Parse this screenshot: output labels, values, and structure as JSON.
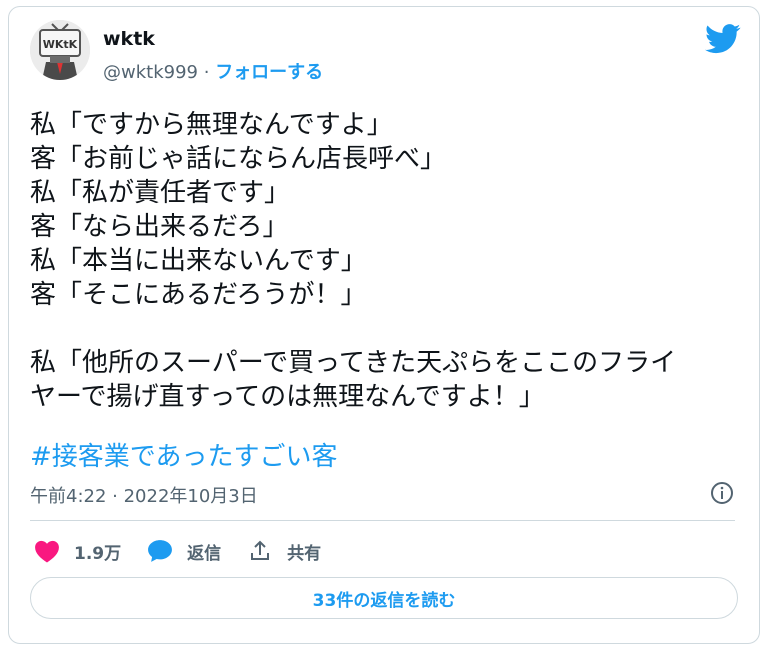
{
  "author": {
    "name": "wktk",
    "handle": "@wktk999",
    "separator": "·",
    "follow_label": "フォローする",
    "avatar_text": "WKtK"
  },
  "tweet": {
    "lines_block1": [
      "私「ですから無理なんですよ」",
      "客「お前じゃ話にならん店長呼べ」",
      "私「私が責任者です」",
      "客「なら出来るだろ」",
      "私「本当に出来ないんです」",
      "客「そこにあるだろうが！」"
    ],
    "lines_block2": [
      "私「他所のスーパーで買ってきた天ぷらをここのフライ",
      "ヤーで揚げ直すってのは無理なんですよ！」"
    ],
    "hashtag": "#接客業であったすごい客",
    "timestamp": "午前4:22 · 2022年10月3日"
  },
  "actions": {
    "like_count": "1.9万",
    "reply_label": "返信",
    "share_label": "共有"
  },
  "read_replies_label": "33件の返信を読む",
  "colors": {
    "accent": "#1d9bf0",
    "like": "#f91880",
    "muted": "#536471",
    "border": "#cfd9de"
  },
  "icons": [
    "twitter-bird-icon",
    "info-icon",
    "heart-icon",
    "reply-bubble-icon",
    "share-icon"
  ]
}
